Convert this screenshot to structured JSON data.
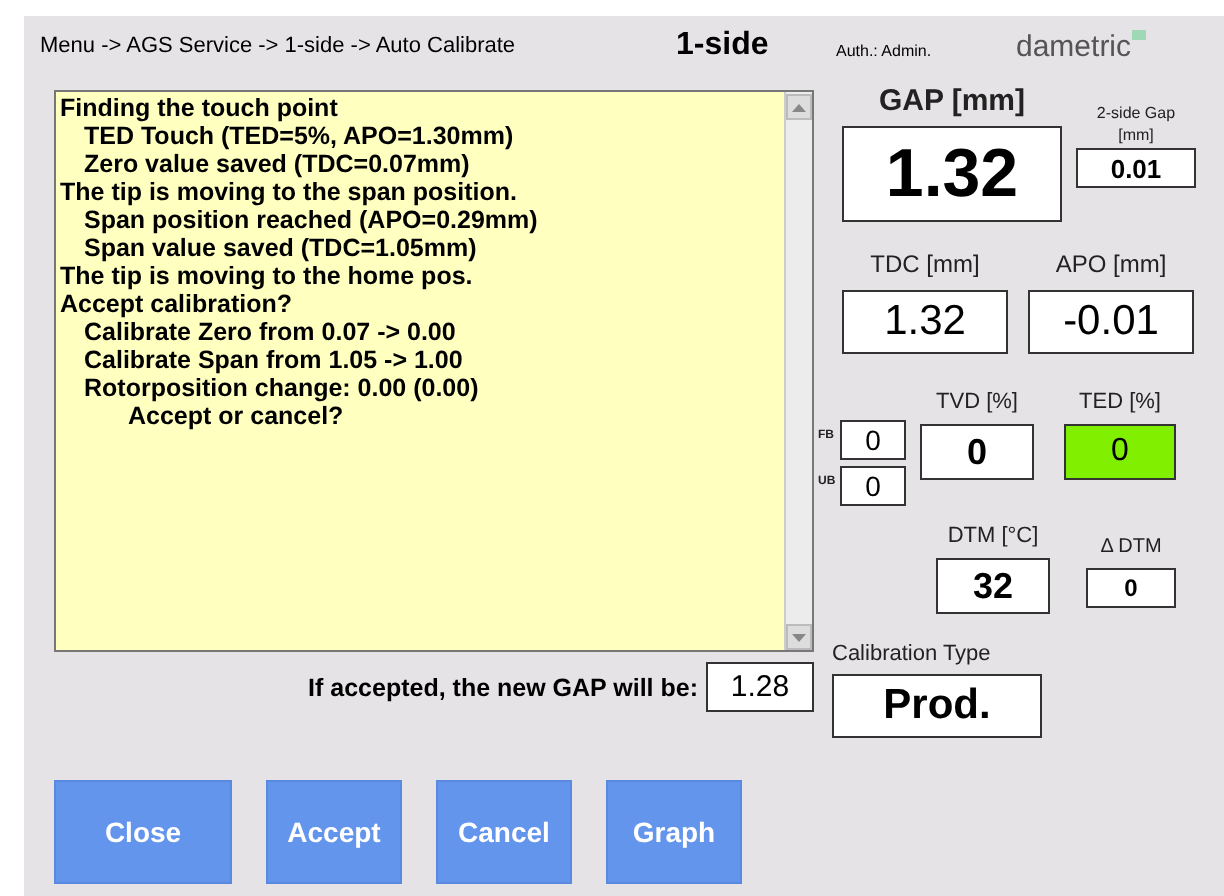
{
  "header": {
    "breadcrumb": "Menu -> AGS Service -> 1-side -> Auto Calibrate",
    "mode": "1-side",
    "auth": "Auth.: Admin.",
    "logo": "dametric"
  },
  "log": {
    "lines": [
      {
        "text": "Finding the touch point",
        "children": [
          {
            "text": "TED Touch (TED=5%, APO=1.30mm)"
          },
          {
            "text": "Zero value saved (TDC=0.07mm)"
          }
        ]
      },
      {
        "text": "The tip is moving to the span position.",
        "children": [
          {
            "text": "Span position reached (APO=0.29mm)"
          },
          {
            "text": "Span value saved (TDC=1.05mm)"
          }
        ]
      },
      {
        "text": "The tip is moving to the home pos."
      },
      {
        "text": "Accept calibration?",
        "children": [
          {
            "text": "Calibrate Zero from 0.07 -> 0.00"
          },
          {
            "text": "Calibrate Span from 1.05 -> 1.00"
          },
          {
            "text": "Rotorposition change: 0.00 (0.00)",
            "children": [
              {
                "text": "Accept or cancel?"
              }
            ]
          }
        ]
      }
    ]
  },
  "new_gap": {
    "label": "If accepted, the new GAP will be:",
    "value": "1.28"
  },
  "readings": {
    "gap": {
      "label": "GAP [mm]",
      "value": "1.32"
    },
    "two_side_gap": {
      "label": "2-side Gap [mm]",
      "value": "0.01"
    },
    "tdc": {
      "label": "TDC [mm]",
      "value": "1.32"
    },
    "apo": {
      "label": "APO [mm]",
      "value": "-0.01"
    },
    "fb": {
      "label": "FB",
      "value": "0"
    },
    "ub": {
      "label": "UB",
      "value": "0"
    },
    "tvd": {
      "label": "TVD [%]",
      "value": "0"
    },
    "ted": {
      "label": "TED [%]",
      "value": "0",
      "color": "#80f000"
    },
    "dtm": {
      "label": "DTM  [°C]",
      "value": "32"
    },
    "delta_dtm": {
      "label": "Δ DTM",
      "value": "0"
    },
    "calibration_type": {
      "label": "Calibration Type",
      "value": "Prod."
    }
  },
  "buttons": [
    "Close",
    "Accept",
    "Cancel",
    "Graph"
  ]
}
